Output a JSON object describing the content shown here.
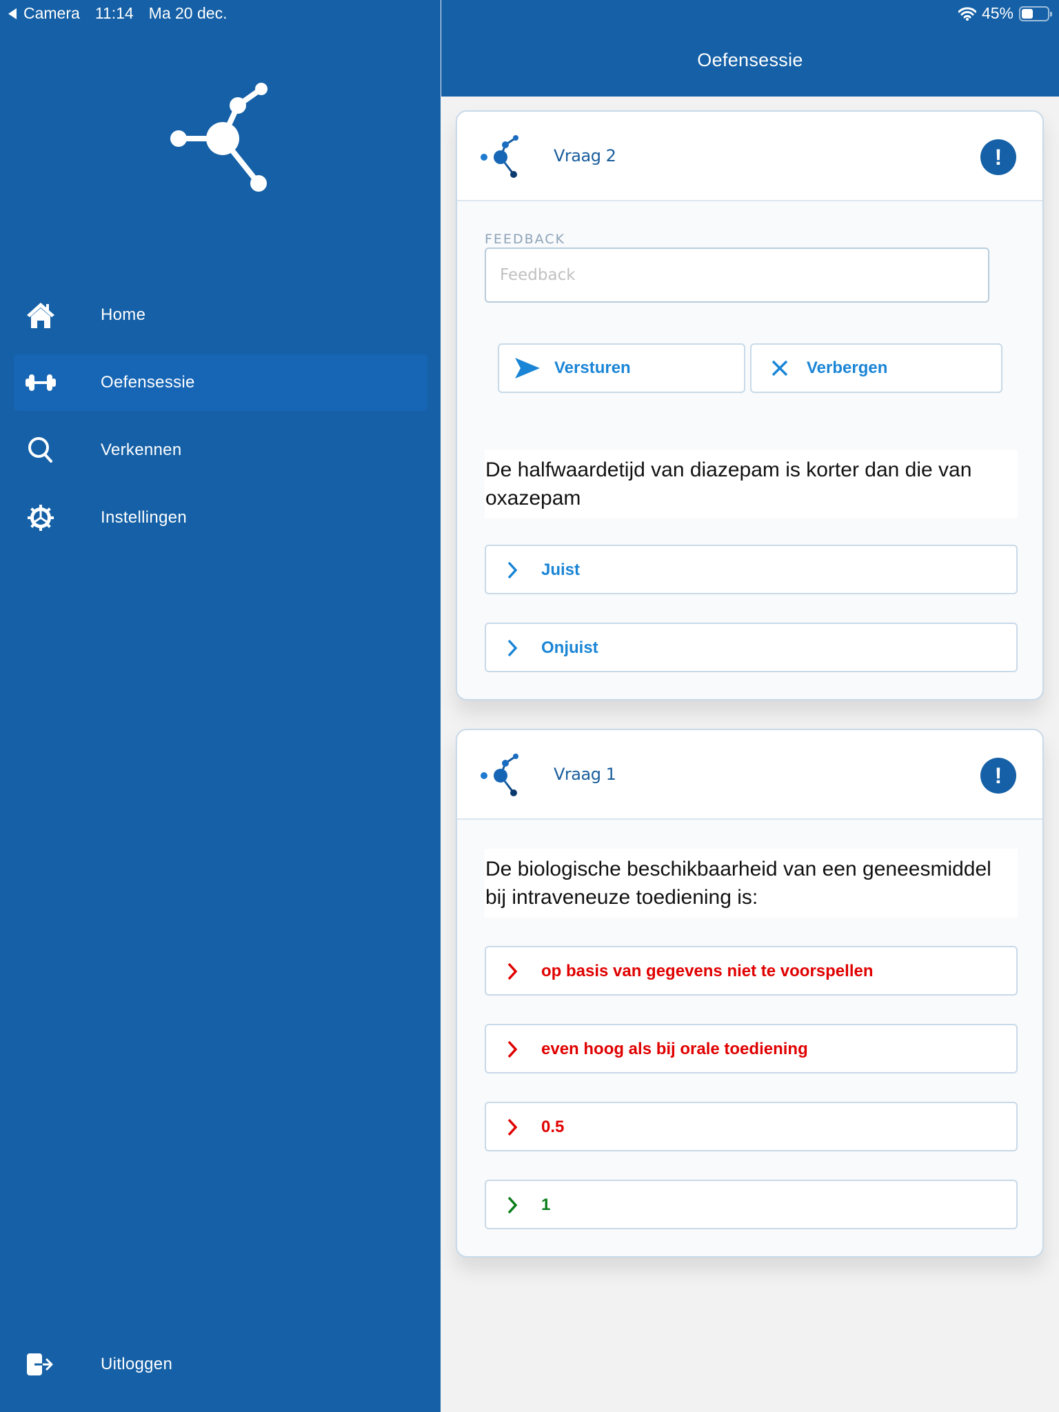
{
  "status_bar": {
    "back_app": "Camera",
    "time": "11:14",
    "date": "Ma 20 dec.",
    "battery_percent_label": "45%",
    "battery_level": 0.45
  },
  "sidebar": {
    "logo_icon": "molecule-logo-icon",
    "items": [
      {
        "label": "Home",
        "icon": "home-icon",
        "active": false
      },
      {
        "label": "Oefensessie",
        "icon": "dumbbell-icon",
        "active": true
      },
      {
        "label": "Verkennen",
        "icon": "search-icon",
        "active": false
      },
      {
        "label": "Instellingen",
        "icon": "gear-icon",
        "active": false
      }
    ],
    "logout": {
      "label": "Uitloggen",
      "icon": "logout-icon"
    }
  },
  "header": {
    "title": "Oefensessie"
  },
  "colors": {
    "brand_blue": "#1560a6",
    "link_blue": "#1a85d6",
    "wrong_red": "#e00000",
    "correct_green": "#0a7d1a"
  },
  "cards": [
    {
      "title": "Vraag 2",
      "alert_icon": "!",
      "feedback": {
        "label": "FEEDBACK",
        "placeholder": "Feedback",
        "value": ""
      },
      "actions": {
        "send_label": "Versturen",
        "hide_label": "Verbergen"
      },
      "question": "De halfwaardetijd van diazepam is korter dan die van oxazepam",
      "answers": [
        {
          "label": "Juist",
          "state": "neutral"
        },
        {
          "label": "Onjuist",
          "state": "neutral"
        }
      ]
    },
    {
      "title": "Vraag 1",
      "alert_icon": "!",
      "question": "De biologische beschikbaarheid van een geneesmiddel bij intraveneuze toediening is:",
      "answers": [
        {
          "label": "op basis van gegevens niet te voorspellen",
          "state": "wrong"
        },
        {
          "label": "even hoog als bij orale toediening",
          "state": "wrong"
        },
        {
          "label": "0.5",
          "state": "wrong"
        },
        {
          "label": "1",
          "state": "correct"
        }
      ]
    }
  ]
}
